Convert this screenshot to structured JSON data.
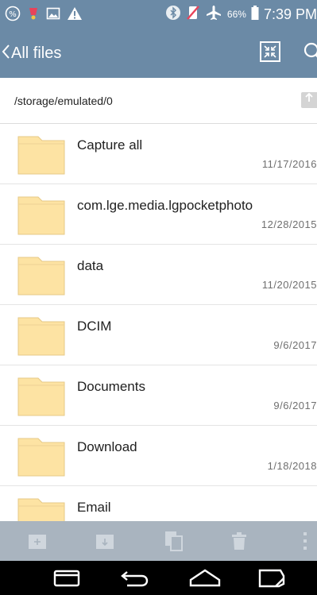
{
  "status_bar": {
    "battery_percent": "66%",
    "time": "7:39 PM",
    "left_icons": [
      "percent-circle-icon",
      "notification-icon",
      "image-icon",
      "warning-icon"
    ],
    "right_icons": [
      "bluetooth-icon",
      "no-sim-icon",
      "airplane-mode-icon",
      "battery-icon"
    ]
  },
  "app_bar": {
    "title": "All files",
    "icons": [
      "back-chevron-icon",
      "collapse-icon",
      "search-icon"
    ]
  },
  "path_bar": {
    "path": "/storage/emulated/0",
    "up_icon": "up-arrow-icon"
  },
  "files": [
    {
      "name": "Capture all",
      "date": "11/17/2016"
    },
    {
      "name": "com.lge.media.lgpocketphoto",
      "date": "12/28/2015"
    },
    {
      "name": "data",
      "date": "11/20/2015"
    },
    {
      "name": "DCIM",
      "date": "9/6/2017"
    },
    {
      "name": "Documents",
      "date": "9/6/2017"
    },
    {
      "name": "Download",
      "date": "1/18/2018"
    },
    {
      "name": "Email",
      "date": ""
    }
  ],
  "bottom_toolbar": {
    "icons": [
      "new-folder-icon",
      "move-icon",
      "copy-icon",
      "delete-icon",
      "more-vert-icon"
    ]
  },
  "nav_bar": {
    "icons": [
      "recent-apps-icon",
      "back-icon",
      "home-icon",
      "dual-window-icon"
    ]
  },
  "colors": {
    "status_bar": "#6b8aa6",
    "app_bar": "#6b8aa6",
    "toolbar": "#a9b4bf",
    "folder_fill": "#fde3a3",
    "nav_bar": "#000000"
  }
}
